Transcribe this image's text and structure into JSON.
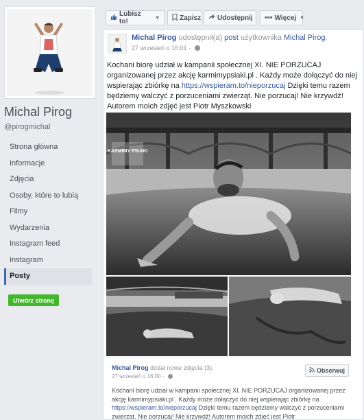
{
  "profile": {
    "name": "Michal Pirog",
    "handle": "@pirogmichal"
  },
  "nav": {
    "items": [
      {
        "label": "Strona główna"
      },
      {
        "label": "Informacje"
      },
      {
        "label": "Zdjęcia"
      },
      {
        "label": "Osoby, które to lubią"
      },
      {
        "label": "Filmy"
      },
      {
        "label": "Wydarzenia"
      },
      {
        "label": "Instagram feed"
      },
      {
        "label": "Instagram"
      },
      {
        "label": "Posty",
        "active": true
      }
    ],
    "create_page": "Utwórz stronę"
  },
  "actions": {
    "like": "Lubisz to!",
    "save": "Zapisz",
    "share": "Udostępnij",
    "more": "Więcej"
  },
  "post": {
    "author": "Michal Pirog",
    "shared_verb": "udostępnił(a)",
    "shared_object": "post",
    "shared_from_prefix": "użytkownika",
    "shared_from": "Michal Pirog",
    "time": "27 wrzesień o 16:01 ·",
    "text_part1": "Kochani biorę udział w kampanii społecznej XI. NIE PORZUCAJ organizowanej przez akcję karmimypsiaki.pl . Każdy może dołączyć do niej wspierając zbiórkę na ",
    "text_url": "https://wspieram.to/nieporzucaj",
    "text_part2": " Dzięki temu razem będziemy walczyć z porzuceniami zwierząt. Nie porzucaj! Nie krzywdź! Autorem moich zdjęć jest Piotr Myszkowski",
    "watermark": "KARMIMY PSIAKI"
  },
  "shared": {
    "author": "Michal Pirog",
    "action": "dodał nowe zdjęcia (3).",
    "time": "27 wrzesień o 16:00 ·",
    "follow": "Obserwuj",
    "text_part1": "Kochani biorę udział w kampanii społecznej XI. NIE PORZUCAJ organizowanej przez akcję karmimypsiaki.pl . Każdy może dołączyć do niej wspierając zbiórkę na ",
    "text_url": "https://wspieram.to/nieporzucaj",
    "text_part2": " Dzięki temu razem będziemy walczyć z porzuceniami zwierząt. Nie porzucaj! Nie krzywdź! Autorem moich zdjęć jest Piotr"
  },
  "icons": {
    "like": "thumbs-up-icon",
    "save": "bookmark-icon",
    "share": "share-arrow-icon",
    "more": "ellipsis-icon",
    "follow": "rss-icon",
    "globe": "globe-icon"
  },
  "colors": {
    "link": "#365899",
    "accent": "#4267b2",
    "create_button": "#42b72a",
    "background": "#e9ebee"
  }
}
